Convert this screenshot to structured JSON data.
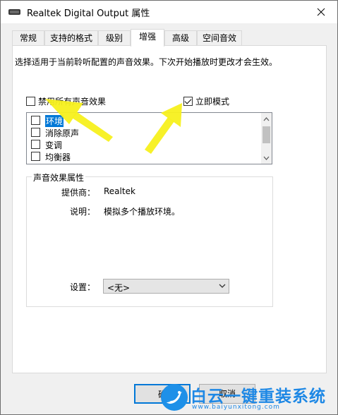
{
  "window": {
    "title": "Realtek Digital Output 属性"
  },
  "tabs": [
    {
      "label": "常规"
    },
    {
      "label": "支持的格式"
    },
    {
      "label": "级别"
    },
    {
      "label": "增强"
    },
    {
      "label": "高级"
    },
    {
      "label": "空间音效"
    }
  ],
  "active_tab": "增强",
  "enhancements": {
    "description": "选择适用于当前聆听配置的声音效果。下次开始播放时更改才会生效。",
    "disable_all": {
      "label": "禁用所有声音效果",
      "checked": false
    },
    "immediate_mode": {
      "label": "立即模式",
      "checked": true
    },
    "effects": [
      {
        "label": "环境",
        "checked": false,
        "selected": true
      },
      {
        "label": "消除原声",
        "checked": false,
        "selected": false
      },
      {
        "label": "变调",
        "checked": false,
        "selected": false
      },
      {
        "label": "均衡器",
        "checked": false,
        "selected": false
      }
    ]
  },
  "properties": {
    "legend": "声音效果属性",
    "provider_label": "提供商：",
    "provider_value": "Realtek",
    "description_label": "说明：",
    "description_value": "模拟多个播放环境。",
    "settings_label": "设置：",
    "settings_value": "<无>"
  },
  "buttons": {
    "ok_label": "确",
    "cancel_label": "取消"
  },
  "watermark": {
    "title": "白云一键重装系统",
    "url": "www.baiyunxitong.com"
  },
  "colors": {
    "accent": "#0078d7",
    "annotation_arrow": "#f7f01e",
    "watermark": "#1e88e5"
  }
}
